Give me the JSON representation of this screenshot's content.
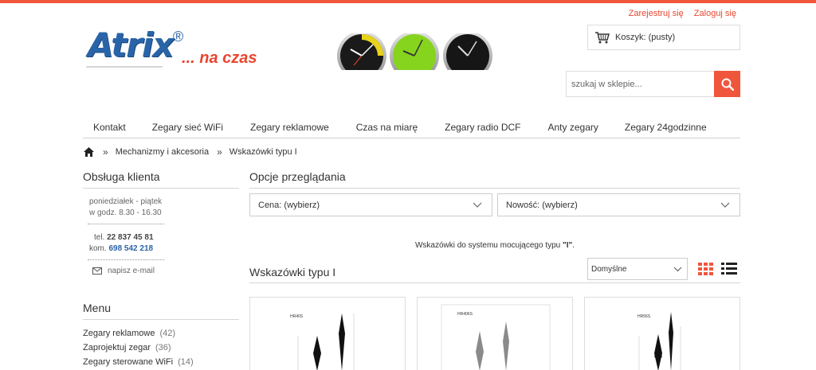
{
  "header": {
    "auth": {
      "register": "Zarejestruj się",
      "login": "Zaloguj się"
    },
    "logo": {
      "brand": "Atrix",
      "reg": "®",
      "tagline": "... na czas"
    },
    "cart": {
      "label": "Koszyk: (pusty)"
    },
    "search": {
      "placeholder": "szukaj w sklepie..."
    }
  },
  "nav": {
    "items": [
      "Kontakt",
      "Zegary sieć WiFi",
      "Zegary reklamowe",
      "Czas na miarę",
      "Zegary radio DCF",
      "Anty zegary",
      "Zegary 24godzinne"
    ]
  },
  "breadcrumb": {
    "sep": "»",
    "items": [
      "Mechanizmy i akcesoria",
      "Wskazówki typu I"
    ]
  },
  "sidebar": {
    "support_title": "Obsługa klienta",
    "hours_line1": "poniedziałek - piątek",
    "hours_line2": "w godz. 8.30 - 16.30",
    "tel_label": "tel.",
    "tel": "22 837 45 81",
    "mob_label": "kom.",
    "mob": "698 542 218",
    "email": "napisz e-mail",
    "menu_title": "Menu",
    "menu": [
      {
        "label": "Zegary reklamowe",
        "count": "(42)"
      },
      {
        "label": "Zaprojektuj zegar",
        "count": "(36)"
      },
      {
        "label": "Zegary sterowane WiFi",
        "count": "(14)"
      }
    ]
  },
  "main": {
    "options_title": "Opcje przeglądania",
    "filter_price": "Cena: (wybierz)",
    "filter_new": "Nowość: (wybierz)",
    "description_pre": "Wskazówki do systemu mocującego typu ",
    "description_bold": "\"I\"",
    "description_post": ".",
    "list_title": "Wskazówki typu I",
    "sort": "Domyślne"
  },
  "products": [
    {
      "model": "HR40S"
    },
    {
      "model": "HR406S"
    },
    {
      "model": "HR56S"
    }
  ],
  "colors": {
    "accent": "#f0563c",
    "brand": "#2a64a8"
  }
}
